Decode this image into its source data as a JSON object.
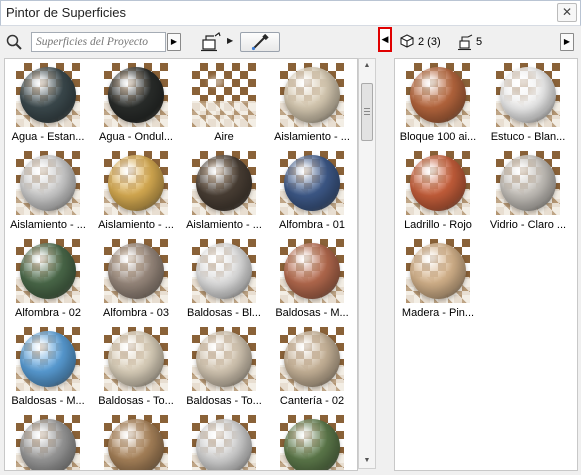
{
  "window": {
    "title": "Pintor de Superficies",
    "close_label": "✕"
  },
  "search": {
    "placeholder": "Superficies del Proyecto",
    "arrow": "▶"
  },
  "toolbar": {
    "small_arrow": "▶",
    "toggle_arrow": "◀"
  },
  "right_header": {
    "surface_count": "2 (3)",
    "paint_count": "5",
    "arrow": "▶"
  },
  "scrollbar": {
    "up_arrow": "▲",
    "down_arrow": "▼"
  },
  "left_items": [
    {
      "label": "Agua - Estan...",
      "color": "#3c4a4e"
    },
    {
      "label": "Agua - Ondul...",
      "color": "#2a2d2b"
    },
    {
      "label": "Aire",
      "color": "transparent"
    },
    {
      "label": "Aislamiento - ...",
      "color": "#d9ccb4"
    },
    {
      "label": "Aislamiento - ...",
      "color": "#cfcfcf"
    },
    {
      "label": "Aislamiento - ...",
      "color": "#d9ad52"
    },
    {
      "label": "Aislamiento - ...",
      "color": "#4a3f35"
    },
    {
      "label": "Alfombra - 01",
      "color": "#3e5a8a"
    },
    {
      "label": "Alfombra - 02",
      "color": "#4b6a4a"
    },
    {
      "label": "Alfombra - 03",
      "color": "#9a8a7e"
    },
    {
      "label": "Baldosas - Bl...",
      "color": "#e2e2e2"
    },
    {
      "label": "Baldosas - M...",
      "color": "#b56a4e"
    },
    {
      "label": "Baldosas - M...",
      "color": "#5a9fd8"
    },
    {
      "label": "Baldosas - To...",
      "color": "#ddd2bd"
    },
    {
      "label": "Baldosas - To...",
      "color": "#d6c9b5"
    },
    {
      "label": "Cantería - 02",
      "color": "#c9b59a"
    },
    {
      "label": "",
      "color": "#9a9a9a"
    },
    {
      "label": "",
      "color": "#a9835a"
    },
    {
      "label": "",
      "color": "#d4d4d4"
    },
    {
      "label": "",
      "color": "#5d7a4b"
    }
  ],
  "right_items": [
    {
      "label": "Bloque 100 ai...",
      "color": "#b8673e"
    },
    {
      "label": "Estuco - Blan...",
      "color": "#f1f1f1"
    },
    {
      "label": "Ladrillo - Rojo",
      "color": "#c75f3b"
    },
    {
      "label": "Vidrio - Claro ...",
      "color": "#c7c3bd"
    },
    {
      "label": "Madera - Pin...",
      "color": "#d6b48c"
    }
  ]
}
